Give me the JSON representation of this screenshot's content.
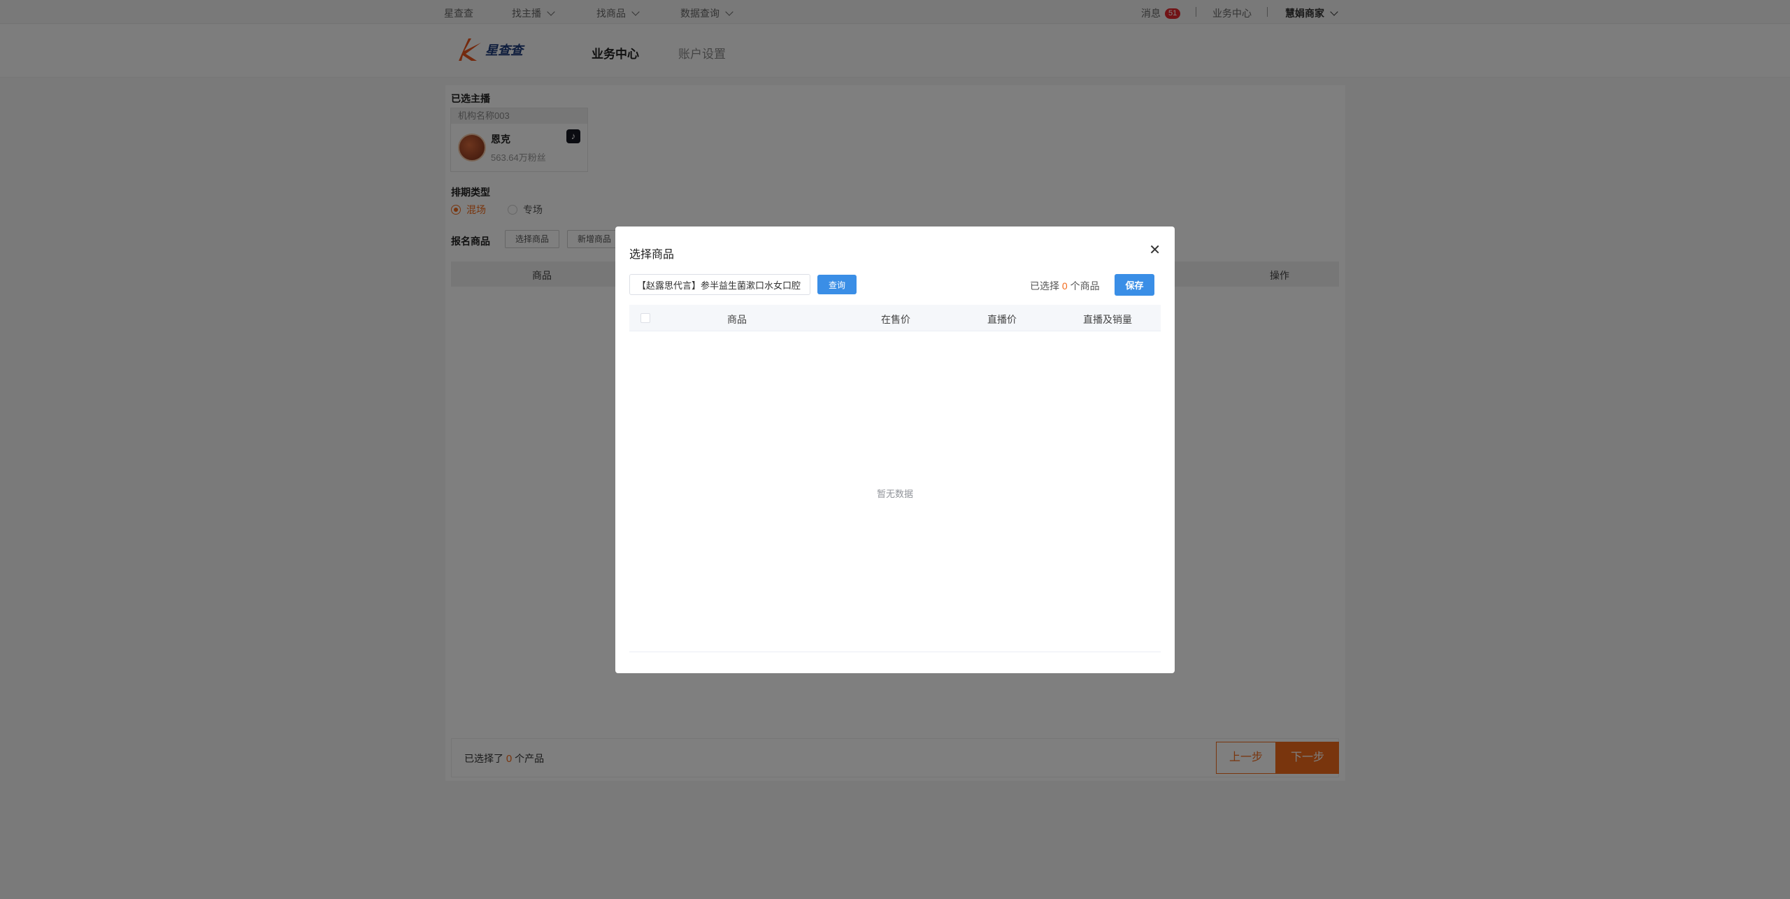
{
  "topbar": {
    "brand": "星查查",
    "find_anchor": "找主播",
    "find_goods": "找商品",
    "data_query": "数据查询",
    "messages": "消息",
    "message_count": "51",
    "business_center": "业务中心",
    "user": "慧娟商家"
  },
  "header": {
    "logo_text": "星查查",
    "nav_business": "业务中心",
    "nav_account": "账户设置"
  },
  "page": {
    "selected_anchor_label": "已选主播",
    "org_name": "机构名称003",
    "anchor_name": "恩克",
    "anchor_fans": "563.64万粉丝",
    "schedule_type_label": "排期类型",
    "option_mixed": "混场",
    "option_special": "专场",
    "signup_goods_label": "报名商品",
    "select_goods_btn": "选择商品",
    "new_goods_btn": "新增商品",
    "col_goods": "商品",
    "col_action": "操作",
    "selected_prefix": "已选择了",
    "selected_count": "0",
    "selected_suffix": "个产品",
    "prev_step": "上一步",
    "next_step": "下一步"
  },
  "modal": {
    "title": "选择商品",
    "search_value": "【赵露思代言】参半益生菌漱口水女口腔",
    "query_btn": "查询",
    "selected_prefix": "已选择",
    "selected_count": "0",
    "selected_suffix": "个商品",
    "save_btn": "保存",
    "columns": [
      "商品",
      "在售价",
      "直播价",
      "直播及销量"
    ],
    "empty_text": "暂无数据"
  }
}
